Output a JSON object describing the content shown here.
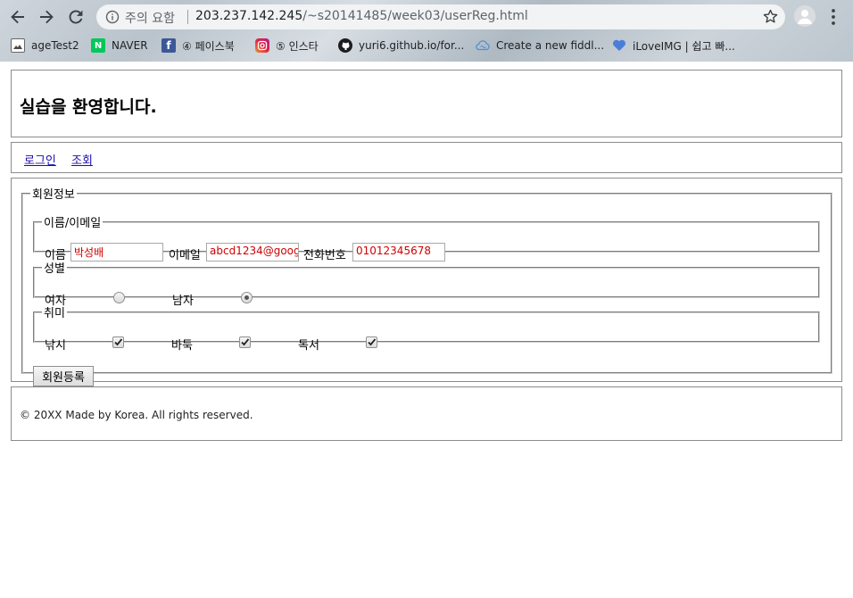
{
  "browser": {
    "security_label": "주의 요함",
    "url_host": "203.237.142.245",
    "url_path": "/~s20141485/week03/userReg.html",
    "bookmarks": [
      {
        "label": "ageTest2",
        "icon": "page-icon"
      },
      {
        "label": "NAVER",
        "icon": "naver-icon"
      },
      {
        "label": "④ 페이스북",
        "icon": "facebook-icon"
      },
      {
        "label": "⑤ 인스타",
        "icon": "instagram-icon"
      },
      {
        "label": "yuri6.github.io/for...",
        "icon": "github-icon"
      },
      {
        "label": "Create a new fiddl...",
        "icon": "cloud-icon"
      },
      {
        "label": "iLoveIMG | 쉽고 빠...",
        "icon": "heart-icon"
      }
    ]
  },
  "header": {
    "title": "실습을 환영합니다."
  },
  "nav": {
    "links": [
      "로그인",
      "조회"
    ]
  },
  "form": {
    "legend": "회원정보",
    "name_section": {
      "legend": "이름/이메일",
      "name_label": "이름",
      "name_value": "박성배",
      "email_label": "이메일",
      "email_value": "abcd1234@goog",
      "phone_label": "전화번호",
      "phone_value": "01012345678"
    },
    "gender_section": {
      "legend": "성별",
      "options": [
        {
          "label": "여자",
          "checked": false
        },
        {
          "label": "남자",
          "checked": true
        }
      ]
    },
    "hobby_section": {
      "legend": "취미",
      "options": [
        {
          "label": "낚시",
          "checked": true
        },
        {
          "label": "바둑",
          "checked": true
        },
        {
          "label": "독서",
          "checked": true
        }
      ]
    },
    "submit_label": "회원등록"
  },
  "footer": {
    "text": "© 20XX Made by Korea. All rights reserved."
  },
  "colors": {
    "input_text": "#d00000",
    "link": "#1a0dab",
    "border": "#8c8c8c"
  }
}
